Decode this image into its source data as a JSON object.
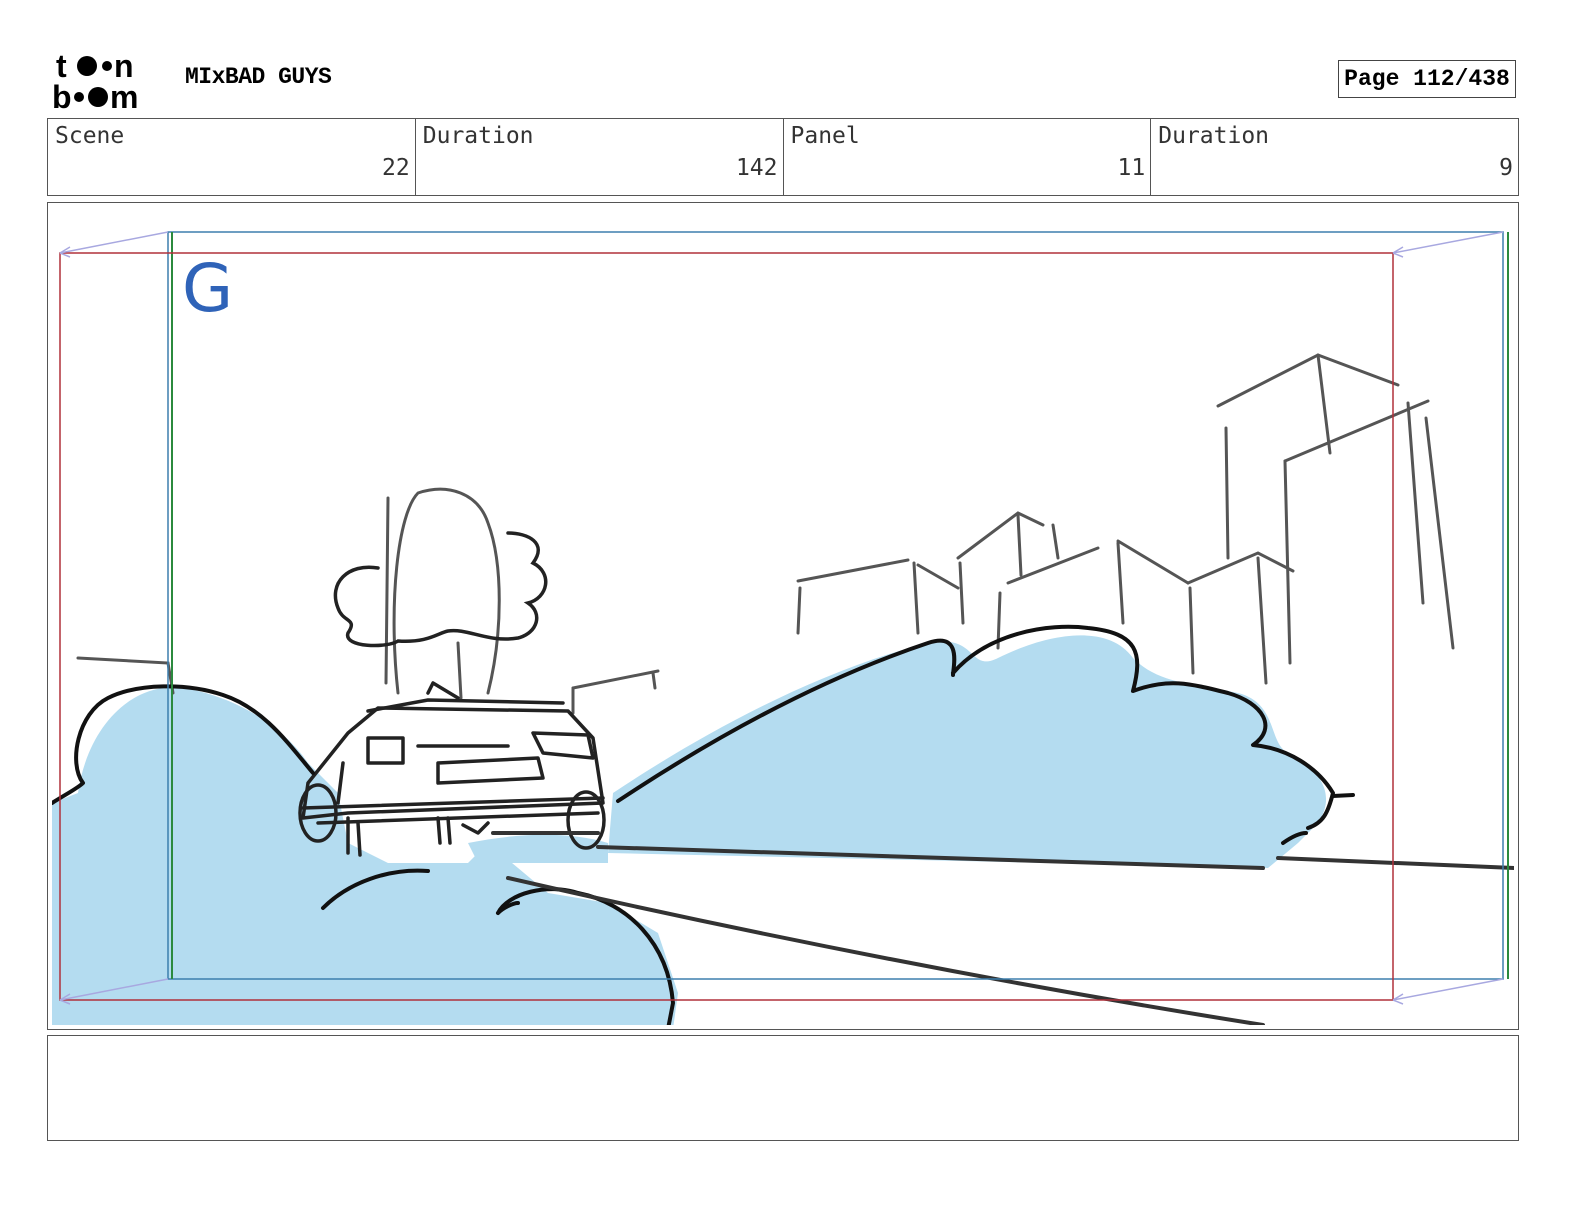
{
  "header": {
    "logo_text": "toon boom",
    "project_title": "MIxBAD GUYS",
    "page_indicator": "Page 112/438"
  },
  "info": {
    "scene_label": "Scene",
    "scene_value": "22",
    "duration_label": "Duration",
    "duration_value": "142",
    "panel_label": "Panel",
    "panel_value": "11",
    "panel_duration_label": "Duration",
    "panel_duration_value": "9"
  },
  "panel": {
    "frame_marker": "G"
  },
  "notes": {
    "text": ""
  },
  "colors": {
    "fill_blue": "#b4dcf0",
    "safe_frame_red": "#b0303a",
    "camera_frame_blue": "#3d7fae",
    "camera_frame_green": "#2b8a3e",
    "marker_blue": "#2f63b8"
  }
}
